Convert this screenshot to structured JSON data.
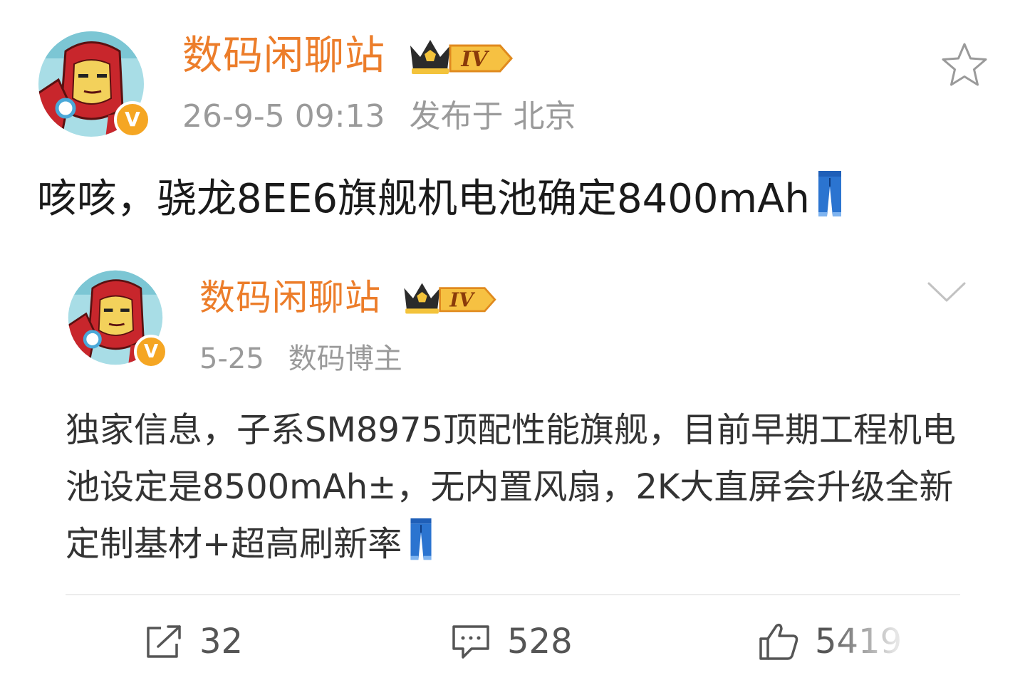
{
  "post": {
    "author": {
      "name": "数码闲聊站",
      "level": "IV",
      "verified_mark": "V"
    },
    "timestamp": "26-9-5 09:13",
    "location": "发布于 北京",
    "text": "咳咳，骁龙8EE6旗舰机电池确定8400mAh",
    "emoji": "jeans-icon"
  },
  "repost": {
    "author": {
      "name": "数码闲聊站",
      "level": "IV",
      "verified_mark": "V"
    },
    "date": "5-25",
    "author_title": "数码博主",
    "text": "独家信息，子系SM8975顶配性能旗舰，目前早期工程机电池设定是8500mAh±，无内置风扇，2K大直屏会升级全新定制基材+超高刷新率",
    "emoji": "jeans-icon"
  },
  "actions": {
    "share_count": "32",
    "comment_count": "528",
    "like_count": "5419"
  },
  "colors": {
    "username": "#ec7d2a",
    "meta": "#9a9a9a",
    "verified": "#f5a623",
    "jeans": "#1f5fb8"
  }
}
